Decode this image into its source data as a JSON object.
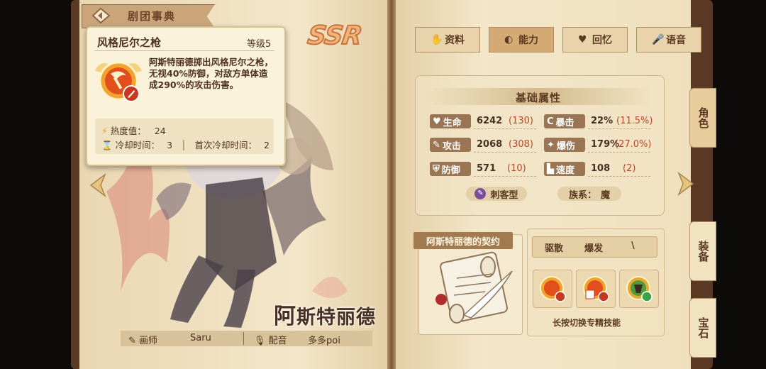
{
  "header": {
    "title": "剧团事典"
  },
  "rarity": "SSR",
  "skill_tooltip": {
    "name": "风格尼尔之枪",
    "level": "等级5",
    "description": "阿斯特丽德掷出风格尼尔之枪，无视40%防御，对敌方单体造成290%的攻击伤害。",
    "heat_label": "热度值：",
    "heat_value": "24",
    "cooldown_label": "冷却时间：",
    "cooldown_value": "3",
    "first_cooldown_label": "首次冷却时间：",
    "first_cooldown_value": "2"
  },
  "character": {
    "name_first": "阿",
    "name_rest": "斯特丽德"
  },
  "credits": {
    "artist_label": "画师",
    "artist": "Saru",
    "voice_label": "配音",
    "voice": "多多poi"
  },
  "tabs": [
    {
      "label": "资料",
      "active": false
    },
    {
      "label": "能力",
      "active": true
    },
    {
      "label": "回忆",
      "active": false
    },
    {
      "label": "语音",
      "active": false
    }
  ],
  "side_tabs": [
    {
      "label": "角色",
      "active": true
    },
    {
      "label": "装备",
      "active": false
    },
    {
      "label": "宝石",
      "active": false
    }
  ],
  "stats": {
    "title": "基础属性",
    "rows": [
      {
        "label": "生命",
        "icon": "heart-icon",
        "value": "6242",
        "bonus": "(130)"
      },
      {
        "label": "暴击",
        "icon": "crit-icon",
        "value": "22%",
        "bonus": "(11.5%)"
      },
      {
        "label": "攻击",
        "icon": "sword-icon",
        "value": "2068",
        "bonus": "(308)"
      },
      {
        "label": "爆伤",
        "icon": "burst-icon",
        "value": "179%",
        "bonus": "(27.0%)"
      },
      {
        "label": "防御",
        "icon": "shield-icon",
        "value": "571",
        "bonus": "(10)"
      },
      {
        "label": "速度",
        "icon": "boot-icon",
        "value": "108",
        "bonus": "(2)"
      }
    ],
    "class_label": "刺客型",
    "faction_label": "族系：",
    "faction_value": "魔"
  },
  "contract": {
    "label": "阿斯特丽德的契约"
  },
  "skills": {
    "tabs": [
      "驱散",
      "爆发",
      "\\"
    ],
    "hint": "长按切换专精技能"
  },
  "colors": {
    "accent": "#9a7553",
    "bonus": "#b64a2a",
    "page": "#f3e6c9"
  }
}
